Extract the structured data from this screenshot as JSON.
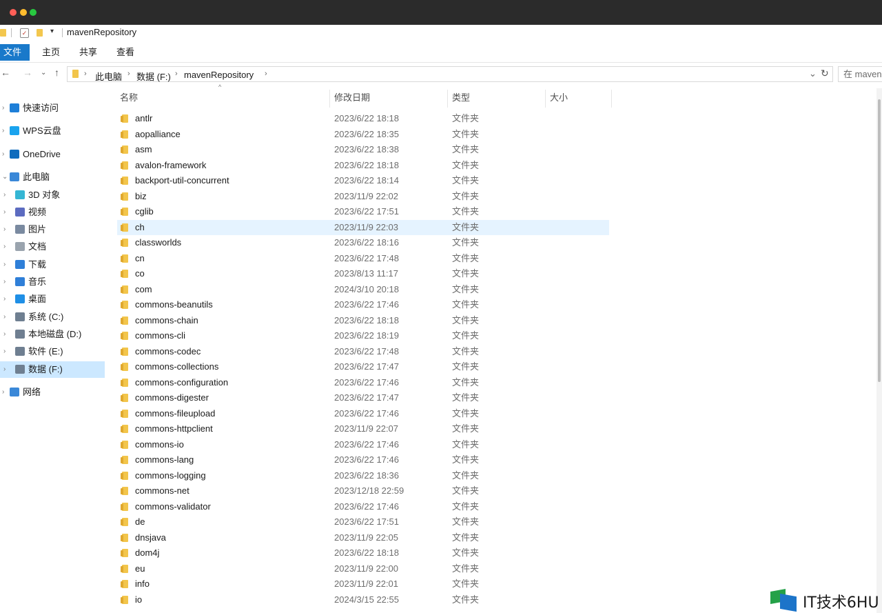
{
  "window": {
    "title": "mavenRepository"
  },
  "ribbon": {
    "tabs": [
      {
        "label": "文件",
        "active": true
      },
      {
        "label": "主页"
      },
      {
        "label": "共享"
      },
      {
        "label": "查看"
      }
    ]
  },
  "address": {
    "crumbs": [
      "此电脑",
      "数据 (F:)",
      "mavenRepository"
    ],
    "search_placeholder": "在 maven"
  },
  "sidebar": {
    "items": [
      {
        "label": "快速访问",
        "icon": "star-icon",
        "color": "#1e7fd8"
      },
      {
        "label": "WPS云盘",
        "icon": "cloud-icon",
        "color": "#1aa3ee"
      },
      {
        "label": "OneDrive",
        "icon": "onedrive-icon",
        "color": "#0f6cbd"
      },
      {
        "label": "此电脑",
        "icon": "computer-icon",
        "color": "#3a88d8"
      },
      {
        "label": "3D 对象",
        "icon": "cube-icon",
        "color": "#35b6d4"
      },
      {
        "label": "视频",
        "icon": "video-icon",
        "color": "#5c6bc0"
      },
      {
        "label": "图片",
        "icon": "pictures-icon",
        "color": "#7a8aa0"
      },
      {
        "label": "文档",
        "icon": "documents-icon",
        "color": "#9aa4ae"
      },
      {
        "label": "下载",
        "icon": "download-icon",
        "color": "#2f7fd8"
      },
      {
        "label": "音乐",
        "icon": "music-icon",
        "color": "#2f7fd8"
      },
      {
        "label": "桌面",
        "icon": "desktop-icon",
        "color": "#1f8fe6"
      },
      {
        "label": "系统 (C:)",
        "icon": "drive-c-icon",
        "color": "#6f7f91"
      },
      {
        "label": "本地磁盘 (D:)",
        "icon": "drive-icon",
        "color": "#6f7f91"
      },
      {
        "label": "软件 (E:)",
        "icon": "drive-icon",
        "color": "#6f7f91"
      },
      {
        "label": "数据 (F:)",
        "icon": "drive-icon",
        "color": "#6f7f91",
        "selected": true
      },
      {
        "label": "网络",
        "icon": "network-icon",
        "color": "#3a88d8"
      }
    ]
  },
  "columns": {
    "name": "名称",
    "date": "修改日期",
    "type": "类型",
    "size": "大小"
  },
  "files": [
    {
      "name": "antlr",
      "date": "2023/6/22 18:18",
      "type": "文件夹"
    },
    {
      "name": "aopalliance",
      "date": "2023/6/22 18:35",
      "type": "文件夹"
    },
    {
      "name": "asm",
      "date": "2023/6/22 18:38",
      "type": "文件夹"
    },
    {
      "name": "avalon-framework",
      "date": "2023/6/22 18:18",
      "type": "文件夹"
    },
    {
      "name": "backport-util-concurrent",
      "date": "2023/6/22 18:14",
      "type": "文件夹"
    },
    {
      "name": "biz",
      "date": "2023/11/9 22:02",
      "type": "文件夹"
    },
    {
      "name": "cglib",
      "date": "2023/6/22 17:51",
      "type": "文件夹"
    },
    {
      "name": "ch",
      "date": "2023/11/9 22:03",
      "type": "文件夹",
      "highlighted": true
    },
    {
      "name": "classworlds",
      "date": "2023/6/22 18:16",
      "type": "文件夹"
    },
    {
      "name": "cn",
      "date": "2023/6/22 17:48",
      "type": "文件夹"
    },
    {
      "name": "co",
      "date": "2023/8/13 11:17",
      "type": "文件夹"
    },
    {
      "name": "com",
      "date": "2024/3/10 20:18",
      "type": "文件夹"
    },
    {
      "name": "commons-beanutils",
      "date": "2023/6/22 17:46",
      "type": "文件夹"
    },
    {
      "name": "commons-chain",
      "date": "2023/6/22 18:18",
      "type": "文件夹"
    },
    {
      "name": "commons-cli",
      "date": "2023/6/22 18:19",
      "type": "文件夹"
    },
    {
      "name": "commons-codec",
      "date": "2023/6/22 17:48",
      "type": "文件夹"
    },
    {
      "name": "commons-collections",
      "date": "2023/6/22 17:47",
      "type": "文件夹"
    },
    {
      "name": "commons-configuration",
      "date": "2023/6/22 17:46",
      "type": "文件夹"
    },
    {
      "name": "commons-digester",
      "date": "2023/6/22 17:47",
      "type": "文件夹"
    },
    {
      "name": "commons-fileupload",
      "date": "2023/6/22 17:46",
      "type": "文件夹"
    },
    {
      "name": "commons-httpclient",
      "date": "2023/11/9 22:07",
      "type": "文件夹"
    },
    {
      "name": "commons-io",
      "date": "2023/6/22 17:46",
      "type": "文件夹"
    },
    {
      "name": "commons-lang",
      "date": "2023/6/22 17:46",
      "type": "文件夹"
    },
    {
      "name": "commons-logging",
      "date": "2023/6/22 18:36",
      "type": "文件夹"
    },
    {
      "name": "commons-net",
      "date": "2023/12/18 22:59",
      "type": "文件夹"
    },
    {
      "name": "commons-validator",
      "date": "2023/6/22 17:46",
      "type": "文件夹"
    },
    {
      "name": "de",
      "date": "2023/6/22 17:51",
      "type": "文件夹"
    },
    {
      "name": "dnsjava",
      "date": "2023/11/9 22:05",
      "type": "文件夹"
    },
    {
      "name": "dom4j",
      "date": "2023/6/22 18:18",
      "type": "文件夹"
    },
    {
      "name": "eu",
      "date": "2023/11/9 22:00",
      "type": "文件夹"
    },
    {
      "name": "info",
      "date": "2023/11/9 22:01",
      "type": "文件夹"
    },
    {
      "name": "io",
      "date": "2024/3/15 22:55",
      "type": "文件夹"
    }
  ],
  "watermark": {
    "text": "IT技术6HU"
  }
}
